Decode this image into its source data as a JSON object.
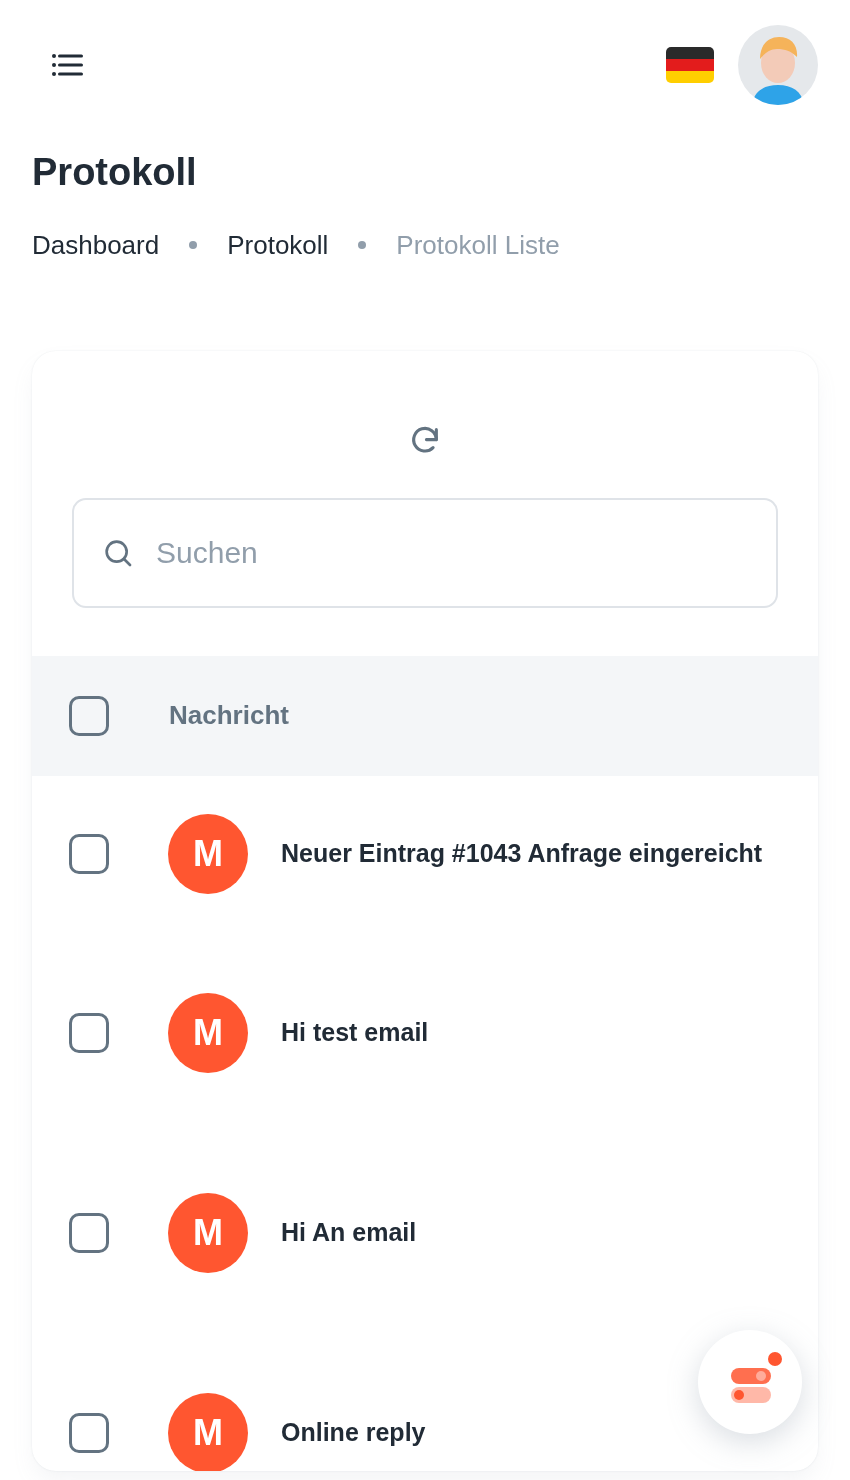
{
  "title": "Protokoll",
  "breadcrumb": [
    {
      "label": "Dashboard",
      "current": false
    },
    {
      "label": "Protokoll",
      "current": false
    },
    {
      "label": "Protokoll Liste",
      "current": true
    }
  ],
  "search": {
    "placeholder": "Suchen"
  },
  "table": {
    "select_all": {
      "checked": false
    },
    "columns": [
      "Nachricht"
    ],
    "rows": [
      {
        "checked": false,
        "avatar": "M",
        "message": "Neuer Eintrag #1043 Anfrage eingereicht"
      },
      {
        "checked": false,
        "avatar": "M",
        "message": "Hi test email"
      },
      {
        "checked": false,
        "avatar": "M",
        "message": "Hi An email"
      },
      {
        "checked": false,
        "avatar": "M",
        "message": "Online reply"
      }
    ]
  }
}
